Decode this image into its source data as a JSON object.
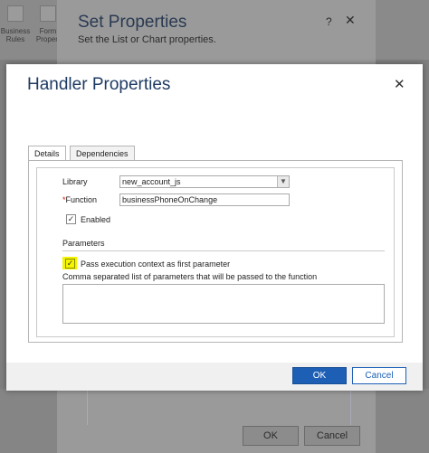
{
  "background": {
    "ribbon": [
      {
        "label_line1": "Business",
        "label_line2": "Rules"
      },
      {
        "label_line1": "Form",
        "label_line2": "Propert"
      }
    ],
    "set_properties": {
      "title": "Set Properties",
      "subtitle": "Set the List or Chart properties.",
      "help": "?",
      "close": "✕",
      "ok_label": "OK",
      "cancel_label": "Cancel"
    }
  },
  "dialog": {
    "title": "Handler Properties",
    "close": "✕",
    "tabs": [
      {
        "label": "Details"
      },
      {
        "label": "Dependencies"
      }
    ],
    "library_label": "Library",
    "library_value": "new_account_js",
    "function_required": "*",
    "function_label": "Function",
    "function_value": "businessPhoneOnChange",
    "enabled_label": "Enabled",
    "enabled_checked": "✓",
    "parameters_heading": "Parameters",
    "pass_context_label": "Pass execution context as first parameter",
    "pass_context_checked": "✓",
    "params_label": "Comma separated list of parameters that will be passed to the function",
    "params_value": "",
    "ok_label": "OK",
    "cancel_label": "Cancel"
  },
  "colors": {
    "accent": "#1d5fb5",
    "highlight": "#f5f500",
    "title": "#1f3b63"
  }
}
